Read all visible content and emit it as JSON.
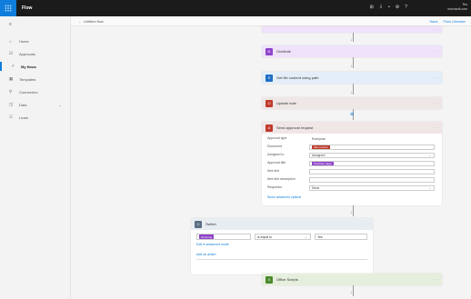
{
  "app": {
    "name": "Flow"
  },
  "topbar": {
    "user": "Tes\nmicrosoft.com"
  },
  "sidebar": {
    "items": [
      {
        "label": "Home",
        "icon": "home-icon",
        "glyph": "⌂"
      },
      {
        "label": "Approvals",
        "icon": "approvals-icon",
        "glyph": "☑"
      },
      {
        "label": "My flows",
        "icon": "flows-icon",
        "glyph": "↗",
        "active": true
      },
      {
        "label": "Templates",
        "icon": "templates-icon",
        "glyph": "▦"
      },
      {
        "label": "Connectors",
        "icon": "connectors-icon",
        "glyph": "⚲"
      },
      {
        "label": "Data",
        "icon": "data-icon",
        "glyph": "◫",
        "expandable": true
      },
      {
        "label": "Learn",
        "icon": "learn-icon",
        "glyph": "☷"
      }
    ]
  },
  "subbar": {
    "flow_name": "Untitled flow",
    "actions": [
      "Save",
      "Flow Checker"
    ]
  },
  "canvas": {
    "cards": [
      {
        "id": "c1",
        "title": "",
        "color": "#8e44c9",
        "bg": "#efe2fa"
      },
      {
        "id": "c2",
        "title": "OneNote",
        "color": "#8e44c9",
        "bg": "#efe2fa"
      },
      {
        "id": "c3",
        "title": "Get file content using path",
        "color": "#1f6fc6",
        "bg": "#e3eef9"
      },
      {
        "id": "c4",
        "title": "Update note",
        "color": "#c0392b",
        "bg": "#efe6e6"
      },
      {
        "id": "c5",
        "title": "Send approval request",
        "color": "#c0392b",
        "bg": "#f1e6e6"
      },
      {
        "id": "c6",
        "title": "Switch",
        "color": "#5a6e82",
        "bg": "#e8edf2"
      },
      {
        "id": "c7",
        "title": "Office Scripts",
        "color": "#4c8a2e",
        "bg": "#e6efdd"
      }
    ],
    "form": {
      "fields": [
        {
          "label": "Approval type",
          "value": "Everyone"
        },
        {
          "label": "Document",
          "value": "File content"
        },
        {
          "label": "Assigned to",
          "value": "Assigned",
          "select": true
        },
        {
          "label": "Approval title",
          "value": "OneNote page"
        },
        {
          "label": "Item link",
          "value": ""
        },
        {
          "label": "Item link description",
          "value": ""
        },
        {
          "label": "Requestor",
          "value": "None",
          "select": true
        }
      ],
      "advanced_link": "Show advanced options"
    },
    "switch": {
      "token": "Outcome",
      "operator": "is equal to",
      "value": "Yes",
      "edit_link": "Edit in advanced mode",
      "add_link": "Add an action"
    }
  },
  "colors": {
    "accent": "#0f7ddb",
    "topbar": "#1b1b1b"
  }
}
